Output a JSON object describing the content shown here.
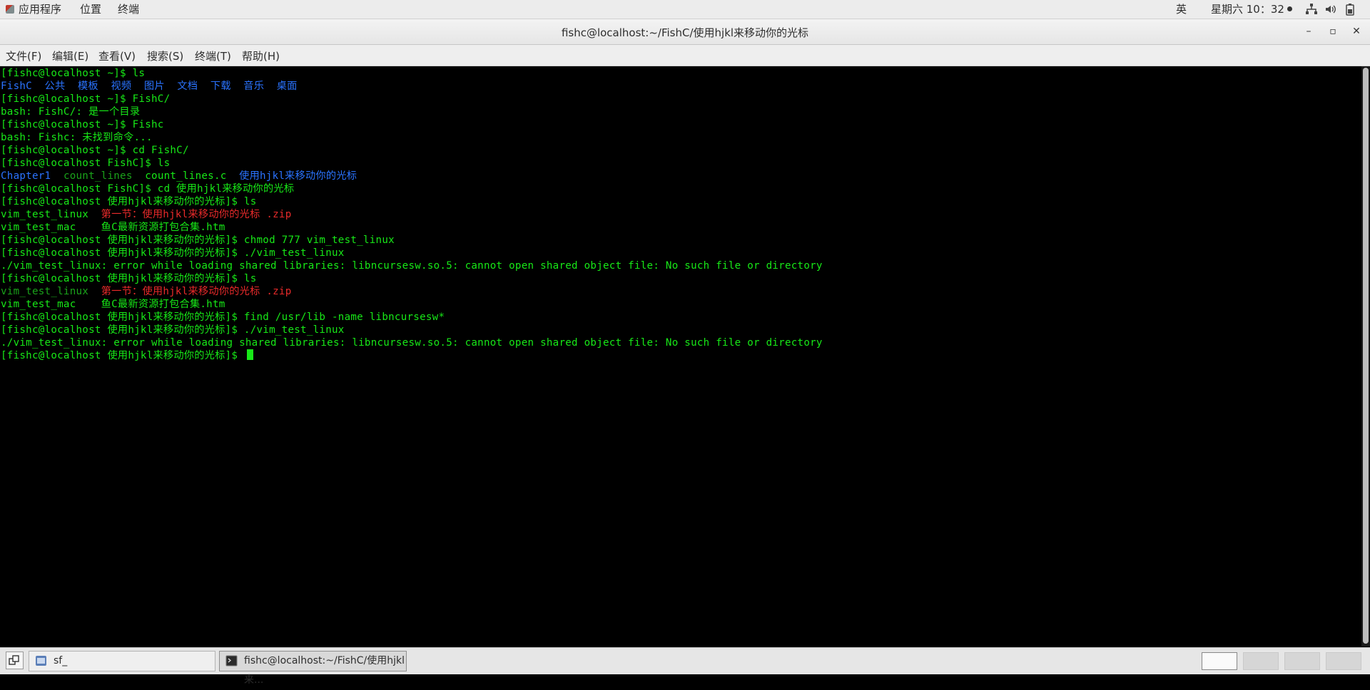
{
  "top_panel": {
    "applications": "应用程序",
    "places": "位置",
    "terminal": "终端",
    "ime": "英",
    "clock": "星期六 10：32"
  },
  "window": {
    "title": "fishc@localhost:~/FishC/使用hjkl来移动你的光标"
  },
  "menubar": {
    "items": [
      "文件(F)",
      "编辑(E)",
      "查看(V)",
      "搜索(S)",
      "终端(T)",
      "帮助(H)"
    ]
  },
  "terminal": {
    "lines": [
      [
        {
          "t": "[fishc@localhost ~]$ ls",
          "c": "g"
        }
      ],
      [
        {
          "t": "FishC  公共  模板  视频  图片  文档  下载  音乐  桌面",
          "c": "b"
        }
      ],
      [
        {
          "t": "[fishc@localhost ~]$ FishC/",
          "c": "g"
        }
      ],
      [
        {
          "t": "bash: FishC/: 是一个目录",
          "c": "g"
        }
      ],
      [
        {
          "t": "[fishc@localhost ~]$ Fishc",
          "c": "g"
        }
      ],
      [
        {
          "t": "bash: Fishc: 未找到命令...",
          "c": "g"
        }
      ],
      [
        {
          "t": "[fishc@localhost ~]$ cd FishC/",
          "c": "g"
        }
      ],
      [
        {
          "t": "[fishc@localhost FishC]$ ls",
          "c": "g"
        }
      ],
      [
        {
          "t": "Chapter1",
          "c": "b"
        },
        {
          "t": "  ",
          "c": "g"
        },
        {
          "t": "count_lines",
          "c": "dg"
        },
        {
          "t": "  count_lines.c  ",
          "c": "g"
        },
        {
          "t": "使用hjkl来移动你的光标",
          "c": "b"
        }
      ],
      [
        {
          "t": "[fishc@localhost FishC]$ cd 使用hjkl来移动你的光标",
          "c": "g"
        }
      ],
      [
        {
          "t": "[fishc@localhost 使用hjkl来移动你的光标]$ ls",
          "c": "g"
        }
      ],
      [
        {
          "t": "vim_test_linux  ",
          "c": "g"
        },
        {
          "t": "第一节：使用hjkl来移动你的光标 .zip",
          "c": "r"
        }
      ],
      [
        {
          "t": "vim_test_mac    鱼C最新资源打包合集.htm",
          "c": "g"
        }
      ],
      [
        {
          "t": "[fishc@localhost 使用hjkl来移动你的光标]$ chmod 777 vim_test_linux",
          "c": "g"
        }
      ],
      [
        {
          "t": "[fishc@localhost 使用hjkl来移动你的光标]$ ./vim_test_linux",
          "c": "g"
        }
      ],
      [
        {
          "t": "./vim_test_linux: error while loading shared libraries: libncursesw.so.5: cannot open shared object file: No such file or directory",
          "c": "g"
        }
      ],
      [
        {
          "t": "[fishc@localhost 使用hjkl来移动你的光标]$ ls",
          "c": "g"
        }
      ],
      [
        {
          "t": "vim_test_linux",
          "c": "dg"
        },
        {
          "t": "  ",
          "c": "g"
        },
        {
          "t": "第一节：使用hjkl来移动你的光标 .zip",
          "c": "r"
        }
      ],
      [
        {
          "t": "vim_test_mac    鱼C最新资源打包合集.htm",
          "c": "g"
        }
      ],
      [
        {
          "t": "[fishc@localhost 使用hjkl来移动你的光标]$ find /usr/lib -name libncursesw*",
          "c": "g"
        }
      ],
      [
        {
          "t": "[fishc@localhost 使用hjkl来移动你的光标]$ ./vim_test_linux",
          "c": "g"
        }
      ],
      [
        {
          "t": "./vim_test_linux: error while loading shared libraries: libncursesw.so.5: cannot open shared object file: No such file or directory",
          "c": "g"
        }
      ],
      [
        {
          "t": "[fishc@localhost 使用hjkl来移动你的光标]$ ",
          "c": "g"
        }
      ]
    ],
    "colors": {
      "green": "#17e817",
      "blue": "#2a73ff",
      "dark_green": "#1aa31a",
      "red": "#e82a2a"
    }
  },
  "taskbar": {
    "task_sf": "sf_",
    "task_terminal": "fishc@localhost:~/FishC/使用hjkl来..."
  }
}
